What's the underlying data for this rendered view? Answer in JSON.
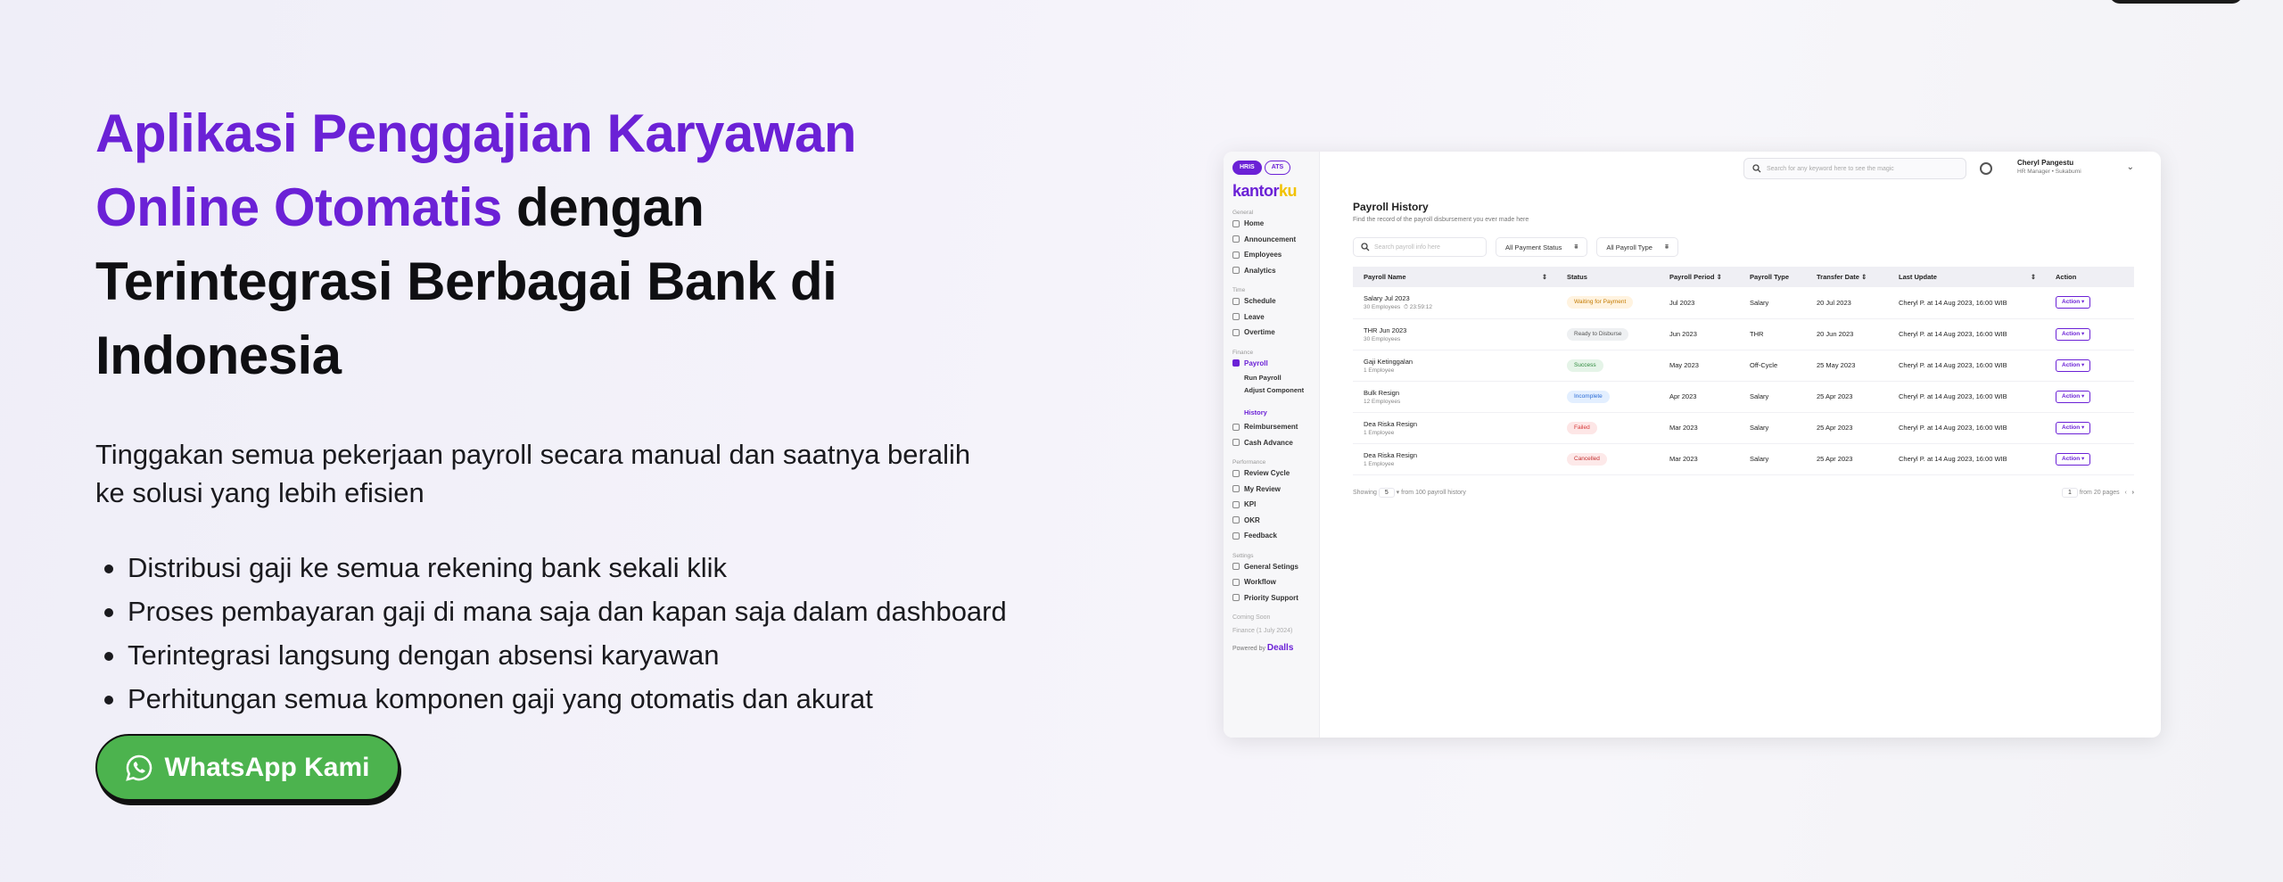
{
  "hero": {
    "title_accent": "Aplikasi Penggajian Karyawan Online Otomatis",
    "title_rest": " dengan Terintegrasi Berbagai Bank di Indonesia",
    "subtitle": "Tinggakan semua pekerjaan payroll secara manual dan saatnya beralih ke solusi yang lebih efisien",
    "bullets": [
      "Distribusi gaji ke semua rekening bank sekali klik",
      "Proses pembayaran gaji di mana saja dan kapan saja dalam dashboard",
      "Terintegrasi langsung dengan absensi karyawan",
      "Perhitungan semua komponen gaji yang otomatis dan akurat"
    ],
    "cta_label": "WhatsApp Kami",
    "cta_icon": "whatsapp-icon",
    "colors": {
      "accent": "#6b21d6",
      "cta": "#4cb34e"
    }
  },
  "mock": {
    "toggle": [
      "HRIS",
      "ATS"
    ],
    "logo_main": "kantor",
    "logo_suffix": "ku",
    "search_placeholder": "Search for any keyword here to see the magic",
    "user_name": "Cheryl Pangestu",
    "user_role": "HR Manager • Sukabumi",
    "sidebar": {
      "general_label": "General",
      "general": [
        "Home",
        "Announcement",
        "Employees",
        "Analytics"
      ],
      "time_label": "Time",
      "time": [
        "Schedule",
        "Leave",
        "Overtime"
      ],
      "finance_label": "Finance",
      "payroll": "Payroll",
      "payroll_sub": [
        "Run Payroll",
        "Adjust Component",
        "History"
      ],
      "finance_rest": [
        "Reimbursement",
        "Cash Advance"
      ],
      "performance_label": "Performance",
      "performance": [
        "Review Cycle",
        "My Review",
        "KPI",
        "OKR",
        "Feedback"
      ],
      "settings_label": "Settings",
      "settings": [
        "General Setings",
        "Workflow",
        "Priority Support"
      ],
      "coming_soon": "Coming Soon",
      "coming_item": "Finance (1 July 2024)",
      "powered_by": "Powered by",
      "powered_brand": "Dealls"
    },
    "page_title": "Payroll History",
    "page_desc": "Find the record of the payroll disbursement you ever made here",
    "filter_search": "Search payroll info here",
    "filter_status": "All Payment Status",
    "filter_type": "All Payroll Type",
    "columns": [
      "Payroll Name",
      "Status",
      "Payroll Period",
      "Payroll Type",
      "Transfer Date",
      "Last Update",
      "Action"
    ],
    "rows": [
      {
        "name": "Salary Jul 2023",
        "sub": "30 Employees",
        "timer": "23:59:12",
        "status": "Waiting for Payment",
        "badge": "b-wait",
        "period": "Jul 2023",
        "type": "Salary",
        "transfer": "20 Jul 2023",
        "update": "Cheryl P. at 14 Aug 2023, 16:00 WIB",
        "action": "Action"
      },
      {
        "name": "THR Jun 2023",
        "sub": "30 Employees",
        "timer": "",
        "status": "Ready to Disburse",
        "badge": "b-ready",
        "period": "Jun 2023",
        "type": "THR",
        "transfer": "20 Jun 2023",
        "update": "Cheryl P. at 14 Aug 2023, 16:00 WIB",
        "action": "Action"
      },
      {
        "name": "Gaji Ketinggalan",
        "sub": "1 Employee",
        "timer": "",
        "status": "Success",
        "badge": "b-success",
        "period": "May 2023",
        "type": "Off-Cycle",
        "transfer": "25 May 2023",
        "update": "Cheryl P. at 14 Aug 2023, 16:00 WIB",
        "action": "Action"
      },
      {
        "name": "Bulk Resign",
        "sub": "12 Employees",
        "timer": "",
        "status": "Incomplete",
        "badge": "b-inc",
        "period": "Apr 2023",
        "type": "Salary",
        "transfer": "25 Apr 2023",
        "update": "Cheryl P. at 14 Aug 2023, 16:00 WIB",
        "action": "Action"
      },
      {
        "name": "Dea Riska Resign",
        "sub": "1 Employee",
        "timer": "",
        "status": "Failed",
        "badge": "b-fail",
        "period": "Mar 2023",
        "type": "Salary",
        "transfer": "25 Apr 2023",
        "update": "Cheryl P. at 14 Aug 2023, 16:00 WIB",
        "action": "Action"
      },
      {
        "name": "Dea Riska Resign",
        "sub": "1 Employee",
        "timer": "",
        "status": "Cancelled",
        "badge": "b-cancel",
        "period": "Mar 2023",
        "type": "Salary",
        "transfer": "25 Apr 2023",
        "update": "Cheryl P. at 14 Aug 2023, 16:00 WIB",
        "action": "Action"
      }
    ],
    "pager": {
      "showing": "Showing",
      "size": "5",
      "from": "from 100 payroll history",
      "page": "1",
      "pages": "from 20 pages"
    }
  }
}
